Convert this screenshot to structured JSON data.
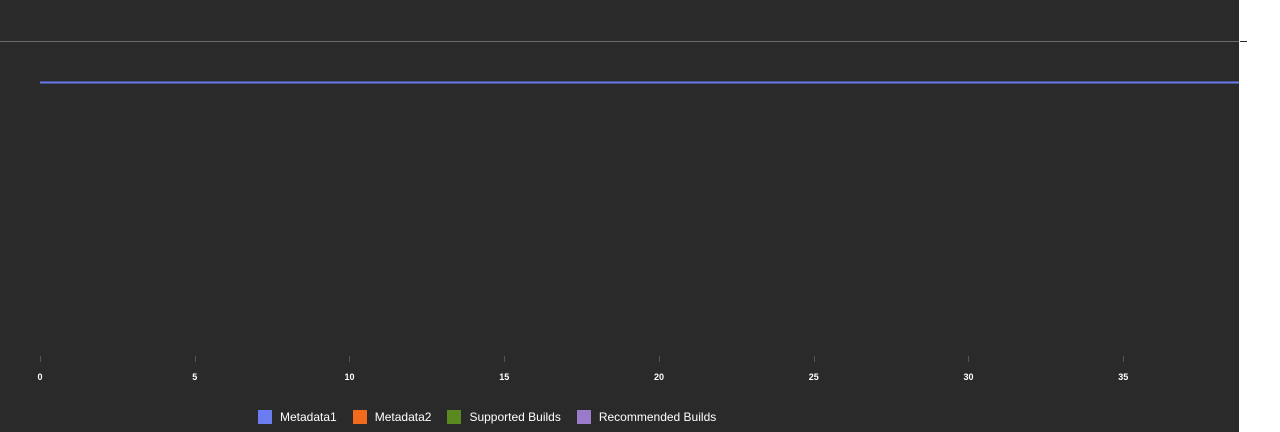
{
  "chart_data": {
    "type": "line",
    "x_ticks": [
      0,
      5,
      10,
      15,
      20,
      25,
      30,
      35
    ],
    "xlim": [
      0,
      39
    ],
    "series": [
      {
        "name": "Metadata1",
        "color": "#6b7bf0",
        "x": [
          0,
          39
        ],
        "y": [
          "max",
          "max"
        ]
      }
    ],
    "legend": {
      "placement": "bottom",
      "entries": [
        {
          "name": "Metadata1",
          "color": "#6b7bf0"
        },
        {
          "name": "Metadata2",
          "color": "#f26b1d"
        },
        {
          "name": "Supported Builds",
          "color": "#5a8a1f"
        },
        {
          "name": "Recommended Builds",
          "color": "#9a7acb"
        }
      ]
    },
    "grid": false,
    "title": "",
    "xlabel": "",
    "ylabel": ""
  },
  "theme": {
    "background": "#2a2a2a",
    "tick_color": "#555555",
    "top_rule_color": "#6a6a6a"
  }
}
